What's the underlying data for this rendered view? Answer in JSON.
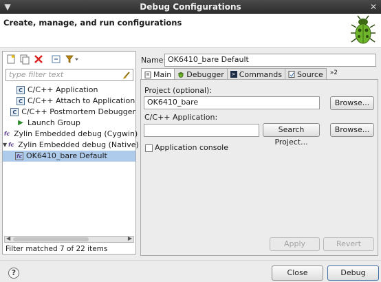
{
  "window": {
    "title": "Debug Configurations"
  },
  "header": {
    "subtitle": "Create, manage, and run configurations"
  },
  "filter": {
    "placeholder": "type filter text"
  },
  "tree": {
    "items": [
      {
        "label": "C/C++ Application",
        "icon": "c-app-icon"
      },
      {
        "label": "C/C++ Attach to Application",
        "icon": "c-attach-icon"
      },
      {
        "label": "C/C++ Postmortem Debugger",
        "icon": "c-postmortem-icon"
      },
      {
        "label": "Launch Group",
        "icon": "launch-group-icon"
      },
      {
        "label": "Zylin Embedded debug (Cygwin)",
        "icon": "zylin-icon"
      },
      {
        "label": "Zylin Embedded debug (Native)",
        "icon": "zylin-icon"
      },
      {
        "label": "OK6410_bare Default",
        "icon": "zylin-config-icon"
      }
    ]
  },
  "status": {
    "filter_matched": "Filter matched 7 of 22 items"
  },
  "config": {
    "name_label": "Name:",
    "name_value": "OK6410_bare Default",
    "tabs": [
      {
        "label": "Main"
      },
      {
        "label": "Debugger"
      },
      {
        "label": "Commands"
      },
      {
        "label": "Source"
      }
    ],
    "tab_overflow": "»2",
    "project_label": "Project (optional):",
    "project_value": "OK6410_bare",
    "browse_label": "Browse...",
    "app_label": "C/C++ Application:",
    "app_value": "",
    "search_project_label": "Search Project...",
    "browse2_label": "Browse...",
    "console_label": "Application console"
  },
  "buttons": {
    "apply": "Apply",
    "revert": "Revert",
    "close": "Close",
    "debug": "Debug"
  },
  "colors": {
    "titlebar": "#2c2c2c",
    "selection": "#aecbeb"
  }
}
